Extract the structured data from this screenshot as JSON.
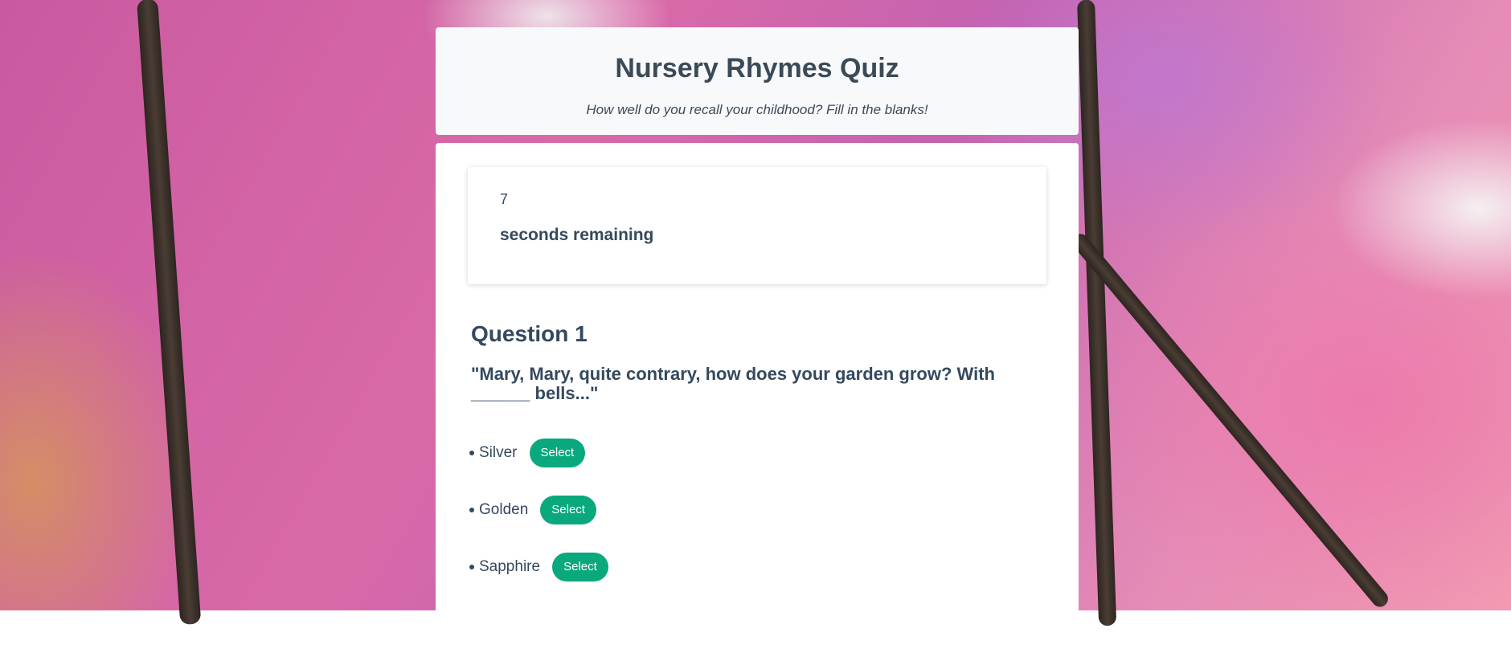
{
  "header": {
    "title": "Nursery Rhymes Quiz",
    "subtitle": "How well do you recall your childhood? Fill in the blanks!"
  },
  "timer": {
    "seconds": "7",
    "label": "seconds remaining"
  },
  "question": {
    "title": "Question 1",
    "text": "\"Mary, Mary, quite contrary, how does your garden grow? With ______ bells...\"",
    "options": [
      {
        "label": "Silver",
        "button": "Select"
      },
      {
        "label": "Golden",
        "button": "Select"
      },
      {
        "label": "Sapphire",
        "button": "Select"
      }
    ]
  },
  "colors": {
    "accent": "#0aa87d",
    "text": "#34495e"
  }
}
